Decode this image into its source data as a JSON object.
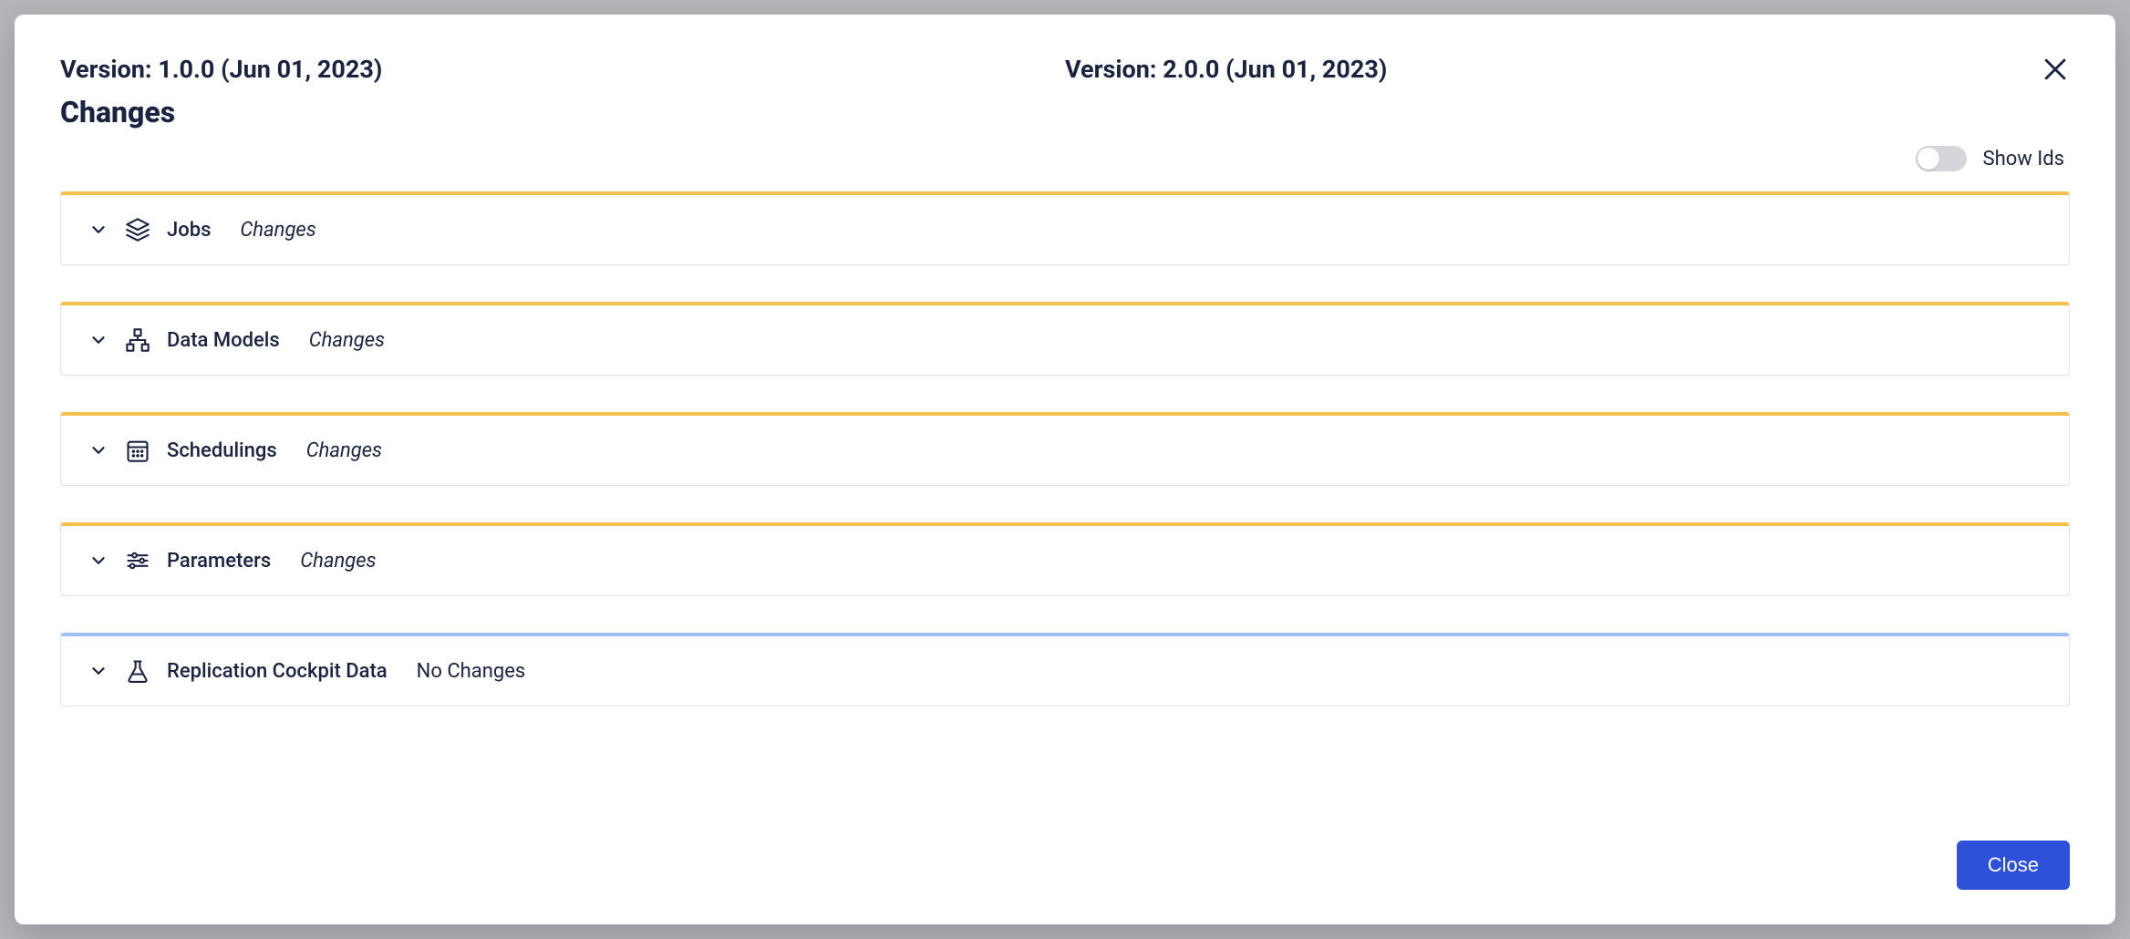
{
  "modal": {
    "version_left": "Version: 1.0.0 (Jun 01, 2023)",
    "version_right": "Version: 2.0.0 (Jun 01, 2023)",
    "heading": "Changes",
    "show_ids_label": "Show Ids",
    "close_button": "Close"
  },
  "sections": [
    {
      "title": "Jobs",
      "status": "Changes",
      "italic": true,
      "accent": "yellow",
      "icon": "layers"
    },
    {
      "title": "Data Models",
      "status": "Changes",
      "italic": true,
      "accent": "yellow",
      "icon": "hierarchy"
    },
    {
      "title": "Schedulings",
      "status": "Changes",
      "italic": true,
      "accent": "yellow",
      "icon": "calendar"
    },
    {
      "title": "Parameters",
      "status": "Changes",
      "italic": true,
      "accent": "yellow",
      "icon": "sliders"
    },
    {
      "title": "Replication Cockpit Data",
      "status": "No Changes",
      "italic": false,
      "accent": "blue",
      "icon": "flask"
    }
  ]
}
